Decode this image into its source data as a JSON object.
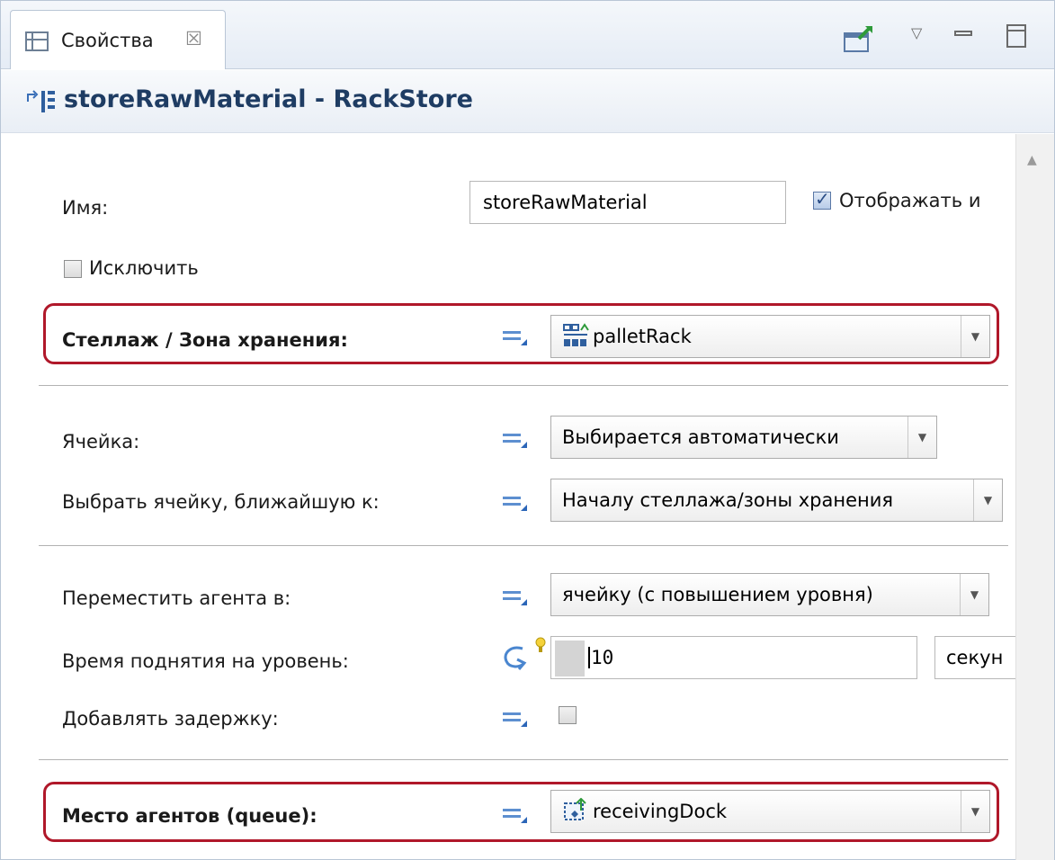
{
  "tab": {
    "label": "Свойства",
    "close": "☒"
  },
  "window_controls": {
    "menu": "▽"
  },
  "header": {
    "title": "storeRawMaterial - RackStore"
  },
  "form": {
    "name_label": "Имя:",
    "name_value": "storeRawMaterial",
    "show_name_label": "Отображать и",
    "show_name_checked": true,
    "exclude_label": "Исключить",
    "exclude_checked": false,
    "rack_label": "Стеллаж / Зона хранения:",
    "rack_value": "palletRack",
    "cell_label": "Ячейка:",
    "cell_value": "Выбирается автоматически",
    "nearest_label": "Выбрать ячейку, ближайшую к:",
    "nearest_value": "Началу стеллажа/зоны хранения",
    "move_label": "Переместить агента в:",
    "move_value": "ячейку (с повышением уровня)",
    "lift_label": "Время поднятия на уровень:",
    "lift_value": "10",
    "lift_unit": "секун",
    "delay_label": "Добавлять задержку:",
    "delay_checked": false,
    "place_label": "Место агентов (queue):",
    "place_value": "receivingDock"
  },
  "icons": {
    "tab": "properties-view-icon",
    "pin": "pin-to-selection-icon",
    "header": "rack-store-block-icon",
    "rack": "pallet-rack-icon",
    "place": "rectangular-node-icon"
  },
  "colors": {
    "highlight": "#b0182a",
    "title": "#1e3c63",
    "static_value_icon": "#2c66b8"
  }
}
